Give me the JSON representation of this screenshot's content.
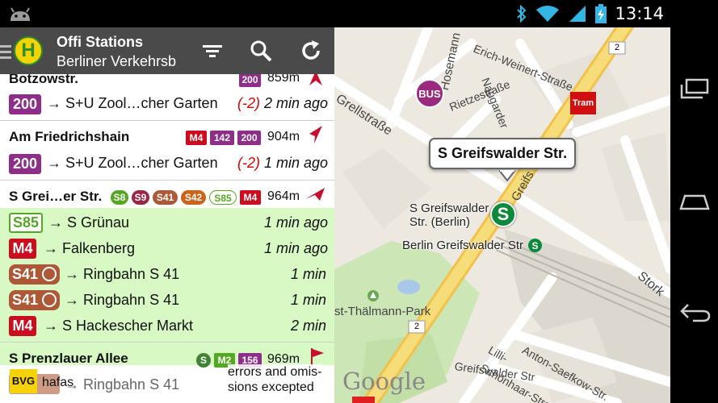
{
  "status_bar": {
    "clock": "13:14",
    "icons": [
      "android-icon",
      "bluetooth-icon",
      "wifi-icon",
      "signal-icon",
      "battery-charging-icon"
    ]
  },
  "action_bar": {
    "title": "Offi Stations",
    "subtitle": "Berliner Verkehrsb",
    "logo_letter": "H",
    "buttons": [
      "filter-icon",
      "search-icon",
      "refresh-icon"
    ]
  },
  "stations": [
    {
      "name": "Botzowstr.",
      "distance": "859m",
      "lines": [
        {
          "label": "200",
          "color": "#8e2e8a"
        }
      ],
      "departures": [
        {
          "line": "200",
          "color": "#8e2e8a",
          "destination": "→ S+U Zool…cher Garten",
          "delay": "(-2)",
          "time": "2 min ago"
        }
      ]
    },
    {
      "name": "Am Friedrichshain",
      "distance": "904m",
      "lines": [
        {
          "label": "M4",
          "color": "#cc0d1f"
        },
        {
          "label": "142",
          "color": "#8e2e8a"
        },
        {
          "label": "200",
          "color": "#8e2e8a"
        }
      ],
      "departures": [
        {
          "line": "200",
          "color": "#8e2e8a",
          "destination": "→ S+U Zool…cher Garten",
          "delay": "(-2)",
          "time": "1 min ago"
        }
      ]
    },
    {
      "name": "S Grei…er Str.",
      "distance": "964m",
      "lines": [
        {
          "label": "S8",
          "color": "#55a822"
        },
        {
          "label": "S9",
          "color": "#992746"
        },
        {
          "label": "S41",
          "color": "#ad5937"
        },
        {
          "label": "S42",
          "color": "#cb6418"
        },
        {
          "label": "S85",
          "color": "#ffffff",
          "text_color": "#55a822"
        },
        {
          "label": "M4",
          "color": "#cc0d1f"
        }
      ],
      "departures": [
        {
          "line": "S85",
          "color": "#ffffff",
          "text_color": "#55a822",
          "destination": "→ S Grünau",
          "time": "1 min ago"
        },
        {
          "line": "M4",
          "color": "#cc0d1f",
          "destination": "→ Falkenberg",
          "time": "1 min ago"
        },
        {
          "line": "S41",
          "color": "#ad5937",
          "ring": true,
          "destination": "→ Ringbahn S 41",
          "time": "1 min"
        },
        {
          "line": "S41",
          "color": "#ad5937",
          "ring": true,
          "destination": "→ Ringbahn S 41",
          "time": "1 min"
        },
        {
          "line": "M4",
          "color": "#cc0d1f",
          "destination": "→ S Hackescher Markt",
          "time": "2 min"
        }
      ]
    },
    {
      "name": "S Prenzlauer Allee",
      "distance": "969m",
      "lines": [
        {
          "label": "S",
          "color": "#408335"
        },
        {
          "label": "M2",
          "color": "#cc0d1f"
        },
        {
          "label": "156",
          "color": "#8e2e8a"
        }
      ],
      "departures": [
        {
          "line": "S41",
          "color": "#ad5937",
          "destination": "→ Ringbahn S 41"
        }
      ]
    }
  ],
  "footer": {
    "operator_logo": "BVG",
    "provider": "hafas",
    "note_line1": "errors and omis-",
    "note_line2": "sions excepted"
  },
  "map": {
    "callout": "S Greifswalder Str.",
    "station_label_line1": "S Greifswalder",
    "station_label_line2": "Str. (Berlin)",
    "station_label_2": "Berlin Greifswalder Str",
    "streets": {
      "grellstrasse": "Grellstraße",
      "hosemann": "Hosemann",
      "erich_weinert": "Erich-Weinert-Straße",
      "naugarder": "Naugarder",
      "rietzestrasse": "Rietzestraße",
      "greifs": "Greifs",
      "stork": "Stork",
      "thaelmann": "st-Thälmann-Park",
      "greifswalder_road": "Greifswalder Str",
      "anton_saefkow": "Anton-Saefkow-Str.",
      "lilli": "Lilli-",
      "schoenhaar": "Schönhaar-Straße"
    },
    "route_number": "2",
    "poi_bus": "BUS",
    "poi_tram": "Tram",
    "poi_s": "S",
    "brand": "Google"
  }
}
